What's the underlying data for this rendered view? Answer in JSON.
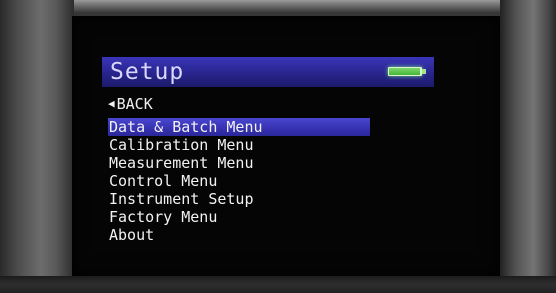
{
  "header": {
    "title": "Setup",
    "battery_icon": "battery-icon",
    "battery_level": 0.97,
    "colors": {
      "titlebar": "#2b2794",
      "battery": "#55c447"
    }
  },
  "nav": {
    "back_icon": "triangle-left-icon",
    "back_glyph": "◀",
    "back_label": "BACK"
  },
  "menu": {
    "selected_index": 0,
    "selection_color": "#3a36b8",
    "items": [
      {
        "label": "Data & Batch Menu"
      },
      {
        "label": "Calibration Menu"
      },
      {
        "label": "Measurement Menu"
      },
      {
        "label": "Control Menu"
      },
      {
        "label": "Instrument Setup"
      },
      {
        "label": "Factory Menu"
      },
      {
        "label": "About"
      }
    ]
  }
}
